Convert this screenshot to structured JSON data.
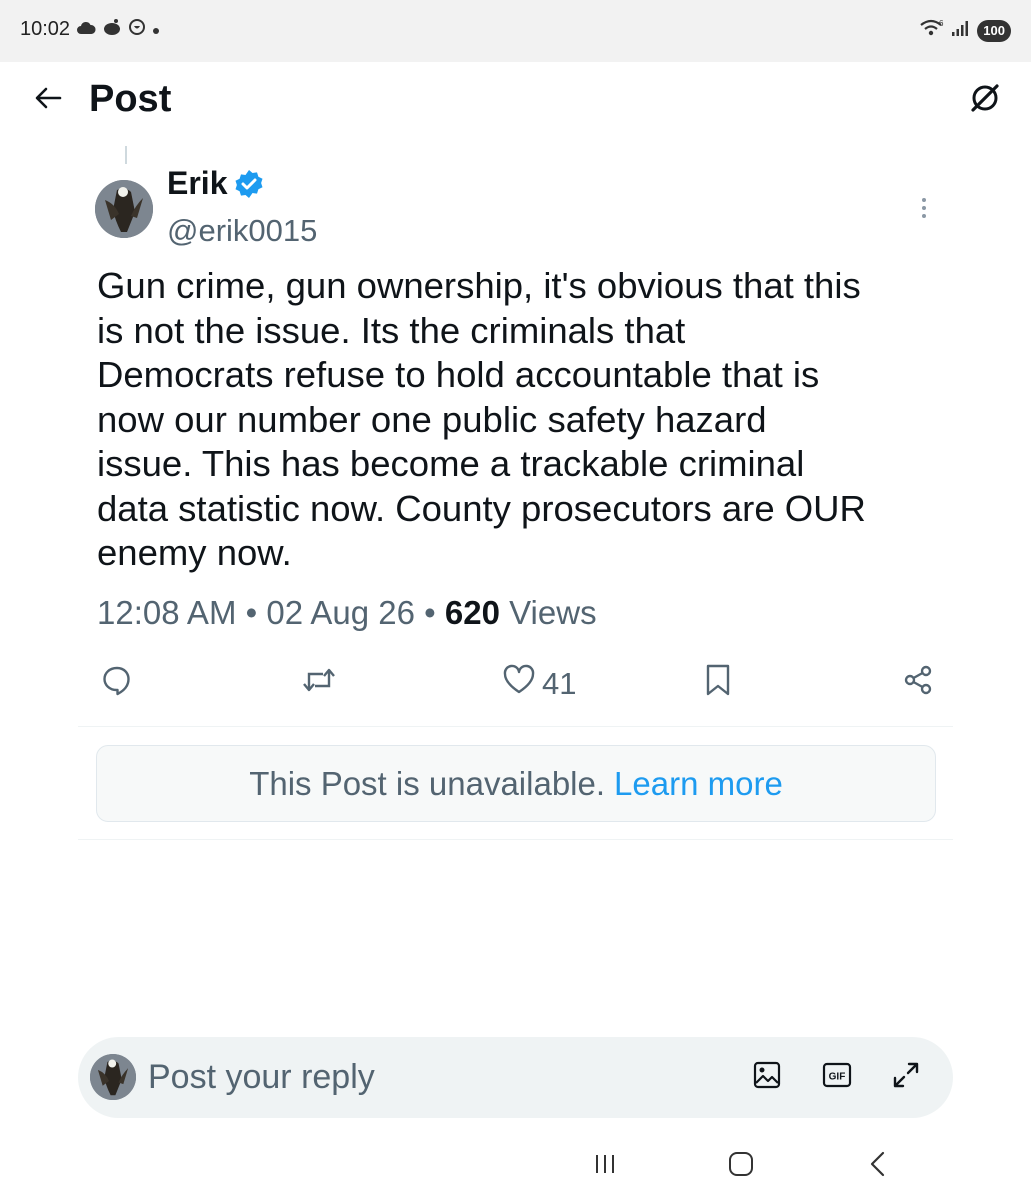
{
  "status_bar": {
    "time": "10:02",
    "left_icons": [
      "cloud-icon",
      "reddit-icon",
      "notification-icon",
      "dot"
    ],
    "network": "6",
    "battery": "100"
  },
  "header": {
    "title": "Post",
    "back_icon": "arrow-left-icon",
    "right_icon": "grok-icon"
  },
  "post": {
    "author_name": "Erik",
    "verified": true,
    "handle": "@erik0015",
    "text": "Gun crime, gun ownership, it's obvious that this\nis not the issue. Its the criminals that\nDemocrats refuse to hold accountable that is\nnow our number one public safety hazard\nissue. This has become a trackable criminal\ndata statistic now. County prosecutors are OUR\nenemy now.",
    "time": "12:08 AM",
    "date": "02 Aug 26",
    "separator": "•",
    "views_count": "620",
    "views_label": "Views",
    "actions": {
      "reply_count": "",
      "repost_count": "",
      "like_count": "41",
      "bookmark_count": ""
    }
  },
  "unavailable": {
    "message": "This Post is unavailable.",
    "link": "Learn more"
  },
  "reply": {
    "placeholder": "Post your reply",
    "gif_label": "GIF"
  },
  "colors": {
    "text_primary": "#0f1419",
    "text_secondary": "#536471",
    "accent": "#1d9bf0"
  }
}
